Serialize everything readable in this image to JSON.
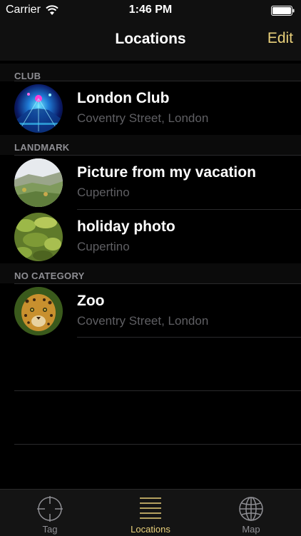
{
  "status_bar": {
    "carrier": "Carrier",
    "time": "1:46 PM"
  },
  "nav": {
    "title": "Locations",
    "edit_label": "Edit",
    "accent_color": "#e9d07a"
  },
  "sections": [
    {
      "header": "CLUB",
      "rows": [
        {
          "title": "London Club",
          "subtitle": "Coventry Street, London",
          "thumb": "club-photo"
        }
      ]
    },
    {
      "header": "LANDMARK",
      "rows": [
        {
          "title": "Picture from my vacation",
          "subtitle": "Cupertino",
          "thumb": "hillside-photo"
        },
        {
          "title": "holiday photo",
          "subtitle": "Cupertino",
          "thumb": "leaves-photo"
        }
      ]
    },
    {
      "header": "NO CATEGORY",
      "rows": [
        {
          "title": "Zoo",
          "subtitle": "Coventry Street, London",
          "thumb": "jaguar-photo"
        }
      ]
    }
  ],
  "tabs": [
    {
      "label": "Tag",
      "icon": "crosshair-icon",
      "active": false
    },
    {
      "label": "Locations",
      "icon": "list-icon",
      "active": true
    },
    {
      "label": "Map",
      "icon": "globe-icon",
      "active": false
    }
  ]
}
